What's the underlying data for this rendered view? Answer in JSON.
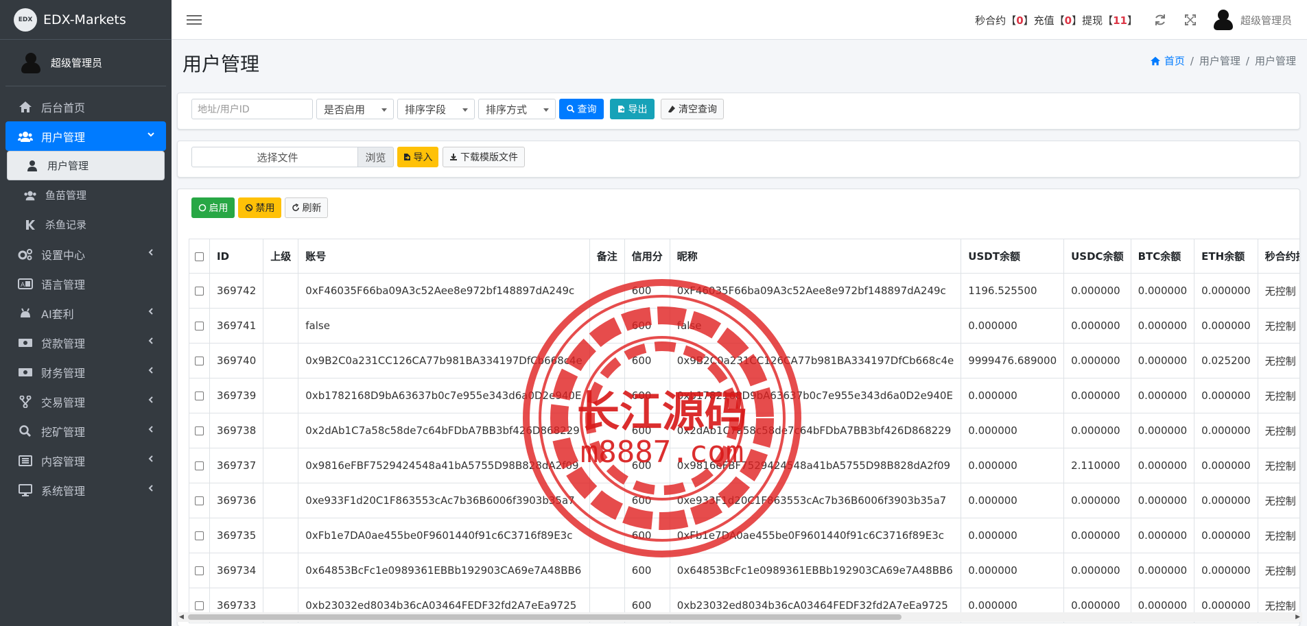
{
  "brand": {
    "name": "EDX-Markets",
    "logo_text": "EDX"
  },
  "user": {
    "name": "超级管理员"
  },
  "sidebar": {
    "items": [
      {
        "label": "后台首页",
        "icon": "home-icon"
      },
      {
        "label": "用户管理",
        "icon": "users-icon",
        "arrow": "chevron-down-icon"
      },
      {
        "label": "用户管理",
        "icon": "user-icon"
      },
      {
        "label": "鱼苗管理",
        "icon": "users-icon"
      },
      {
        "label": "杀鱼记录",
        "icon": "k-icon"
      },
      {
        "label": "设置中心",
        "icon": "cogs-icon",
        "arrow": "chevron-left-icon"
      },
      {
        "label": "语言管理",
        "icon": "language-icon"
      },
      {
        "label": "AI套利",
        "icon": "android-icon",
        "arrow": "chevron-left-icon"
      },
      {
        "label": "贷款管理",
        "icon": "money-icon",
        "arrow": "chevron-left-icon"
      },
      {
        "label": "财务管理",
        "icon": "money-icon",
        "arrow": "chevron-left-icon"
      },
      {
        "label": "交易管理",
        "icon": "branch-icon",
        "arrow": "chevron-left-icon"
      },
      {
        "label": "挖矿管理",
        "icon": "search-icon",
        "arrow": "chevron-left-icon"
      },
      {
        "label": "内容管理",
        "icon": "list-icon",
        "arrow": "chevron-left-icon"
      },
      {
        "label": "系统管理",
        "icon": "desktop-icon",
        "arrow": "chevron-left-icon"
      }
    ]
  },
  "topbar": {
    "stat1_label": "秒合约【",
    "stat1_value": "0",
    "stat2_label": "】充值【",
    "stat2_value": "0",
    "stat3_label": "】提现【",
    "stat3_value": "11",
    "stat_end": "】",
    "user": "超级管理员"
  },
  "page": {
    "title": "用户管理"
  },
  "breadcrumb": {
    "home": "首页",
    "level1": "用户管理",
    "level2": "用户管理",
    "sep": "/"
  },
  "filter": {
    "search_placeholder": "地址/用户ID",
    "enabled_select": "是否启用",
    "sort_field_select": "排序字段",
    "sort_order_select": "排序方式",
    "query_button": "查询",
    "export_button": "导出",
    "clear_button": "清空查询"
  },
  "import": {
    "file_placeholder": "选择文件",
    "browse_button": "浏览",
    "import_button": "导入",
    "download_button": "下载模版文件"
  },
  "actions": {
    "enable": "启用",
    "disable": "禁用",
    "refresh": "刷新"
  },
  "table": {
    "columns": [
      "ID",
      "上级",
      "账号",
      "备注",
      "信用分",
      "昵称",
      "USDT余额",
      "USDC余额",
      "BTC余额",
      "ETH余额",
      "秒合约控制"
    ],
    "rows": [
      {
        "id": "369742",
        "parent": "",
        "account": "0xF46035F66ba09A3c52Aee8e972bf148897dA249c",
        "note": "",
        "credit": "600",
        "nickname": "0xF46035F66ba09A3c52Aee8e972bf148897dA249c",
        "usdt": "1196.525500",
        "usdc": "0.000000",
        "btc": "0.000000",
        "eth": "0.000000",
        "control": "无控制"
      },
      {
        "id": "369741",
        "parent": "",
        "account": "false",
        "note": "",
        "credit": "600",
        "nickname": "false",
        "usdt": "0.000000",
        "usdc": "0.000000",
        "btc": "0.000000",
        "eth": "0.000000",
        "control": "无控制"
      },
      {
        "id": "369740",
        "parent": "",
        "account": "0x9B2C0a231CC126CA77b981BA334197DfCb668c4e",
        "note": "",
        "credit": "600",
        "nickname": "0x9B2C0a231CC126CA77b981BA334197DfCb668c4e",
        "usdt": "9999476.689000",
        "usdc": "0.000000",
        "btc": "0.000000",
        "eth": "0.025200",
        "control": "无控制"
      },
      {
        "id": "369739",
        "parent": "",
        "account": "0xb1782168D9bA63637b0c7e955e343d6a0D2e940E",
        "note": "",
        "credit": "600",
        "nickname": "0xb1782168D9bA63637b0c7e955e343d6a0D2e940E",
        "usdt": "0.000000",
        "usdc": "0.000000",
        "btc": "0.000000",
        "eth": "0.000000",
        "control": "无控制"
      },
      {
        "id": "369738",
        "parent": "",
        "account": "0x2dAb1C7a58c58de7c64bFDbA7BB3bf426D868229",
        "note": "",
        "credit": "600",
        "nickname": "0x2dAb1C7a58c58de7c64bFDbA7BB3bf426D868229",
        "usdt": "0.000000",
        "usdc": "0.000000",
        "btc": "0.000000",
        "eth": "0.000000",
        "control": "无控制"
      },
      {
        "id": "369737",
        "parent": "",
        "account": "0x9816eFBF7529424548a41bA5755D98B828dA2f09",
        "note": "",
        "credit": "600",
        "nickname": "0x9816eFBF7529424548a41bA5755D98B828dA2f09",
        "usdt": "0.000000",
        "usdc": "2.110000",
        "btc": "0.000000",
        "eth": "0.000000",
        "control": "无控制"
      },
      {
        "id": "369736",
        "parent": "",
        "account": "0xe933F1d20C1F863553cAc7b36B6006f3903b35a7",
        "note": "",
        "credit": "600",
        "nickname": "0xe933F1d20C1F863553cAc7b36B6006f3903b35a7",
        "usdt": "0.000000",
        "usdc": "0.000000",
        "btc": "0.000000",
        "eth": "0.000000",
        "control": "无控制"
      },
      {
        "id": "369735",
        "parent": "",
        "account": "0xFb1e7DA0ae455be0F9601440f91c6C3716f89E3c",
        "note": "",
        "credit": "600",
        "nickname": "0xFb1e7DA0ae455be0F9601440f91c6C3716f89E3c",
        "usdt": "0.000000",
        "usdc": "0.000000",
        "btc": "0.000000",
        "eth": "0.000000",
        "control": "无控制"
      },
      {
        "id": "369734",
        "parent": "",
        "account": "0x64853BcFc1e0989361EBBb192903CA69e7A48BB6",
        "note": "",
        "credit": "600",
        "nickname": "0x64853BcFc1e0989361EBBb192903CA69e7A48BB6",
        "usdt": "0.000000",
        "usdc": "0.000000",
        "btc": "0.000000",
        "eth": "0.000000",
        "control": "无控制"
      },
      {
        "id": "369733",
        "parent": "",
        "account": "0xb23032ed8034b36cA03464FEDF32fd2A7eEa9725",
        "note": "",
        "credit": "600",
        "nickname": "0xb23032ed8034b36cA03464FEDF32fd2A7eEa9725",
        "usdt": "0.000000",
        "usdc": "0.000000",
        "btc": "0.000000",
        "eth": "0.000000",
        "control": "无控制"
      }
    ]
  },
  "watermark": {
    "line1": "长江源码",
    "line2": "m8887.com"
  },
  "colors": {
    "sidebar_bg": "#343a40",
    "primary": "#007bff",
    "teal": "#17a2b8",
    "warning": "#ffc107",
    "success": "#28a745",
    "danger": "#dc3545",
    "watermark": "#e02020"
  }
}
